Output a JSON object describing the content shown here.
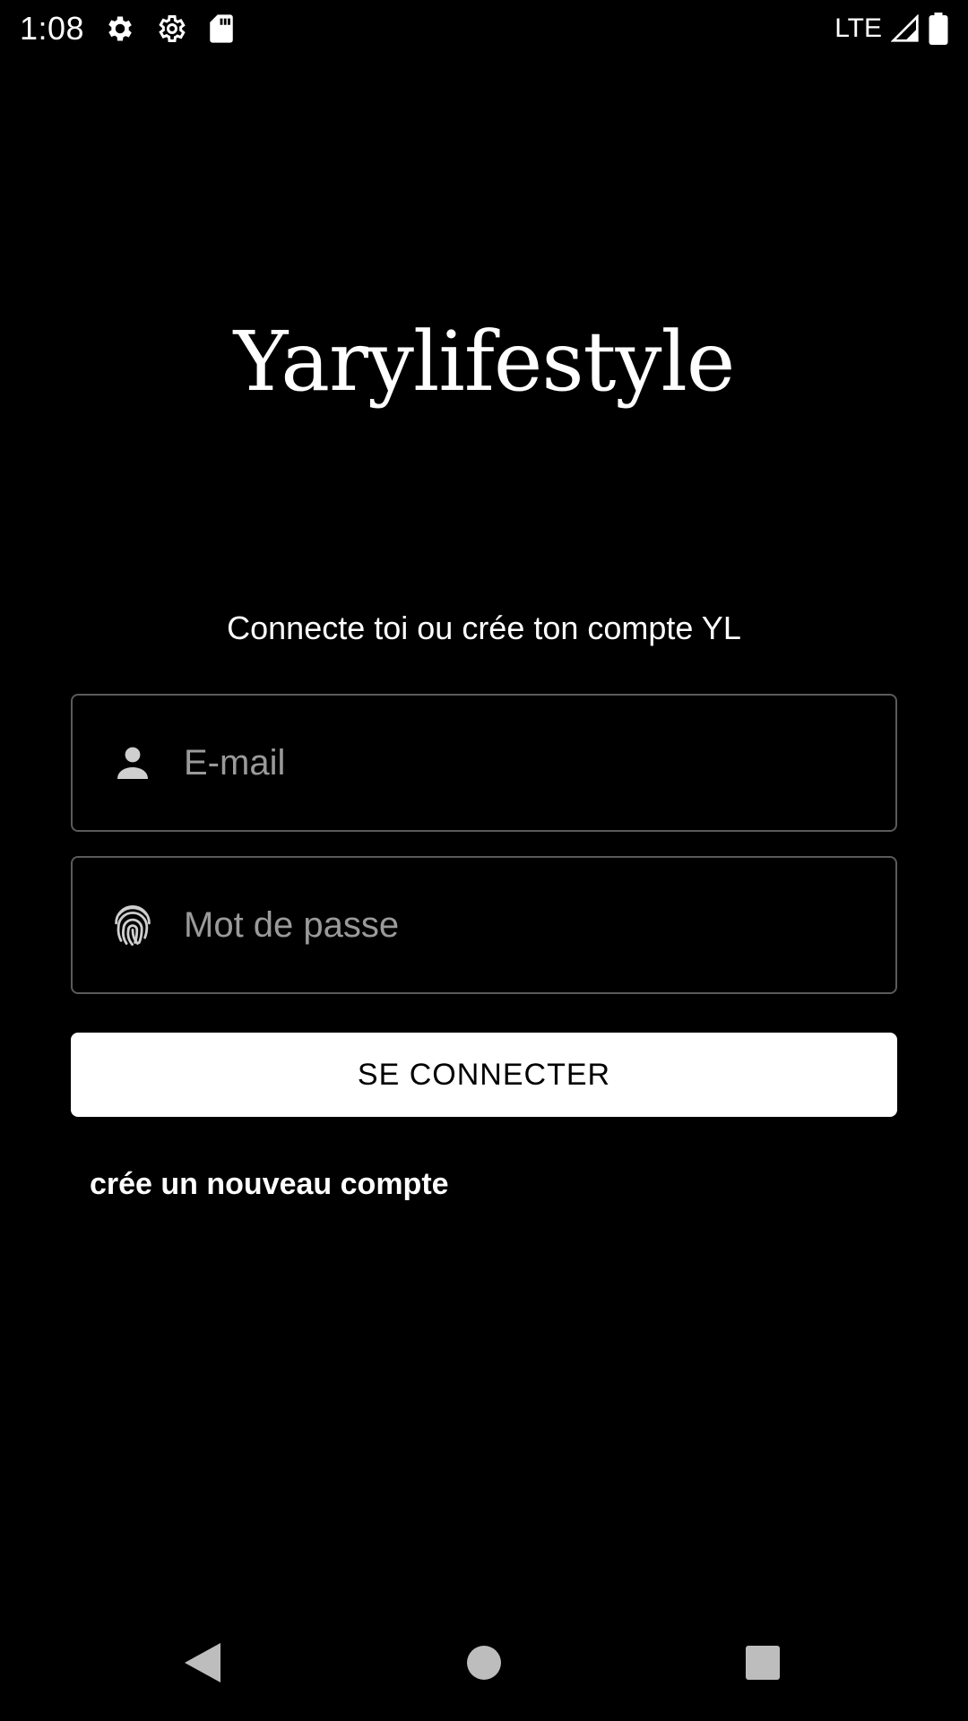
{
  "status_bar": {
    "time": "1:08",
    "network": "LTE",
    "icons": [
      "settings-icon",
      "settings-icon",
      "sd-card-icon",
      "signal-icon",
      "battery-icon"
    ]
  },
  "logo_text": "Yarylifestyle",
  "subtitle": "Connecte toi ou crée ton compte YL",
  "email_field": {
    "placeholder": "E-mail",
    "value": "",
    "icon": "person-icon"
  },
  "password_field": {
    "placeholder": "Mot de passe",
    "value": "",
    "icon": "fingerprint-icon"
  },
  "login_button_label": "SE CONNECTER",
  "create_account_link": "crée un nouveau compte",
  "nav_bar": {
    "icons": [
      "back-icon",
      "home-icon",
      "recents-icon"
    ]
  },
  "colors": {
    "background": "#000000",
    "text": "#ffffff",
    "placeholder": "#9a9a9a",
    "field_border": "#5a5a5a",
    "button_bg": "#ffffff",
    "button_text": "#000000"
  }
}
